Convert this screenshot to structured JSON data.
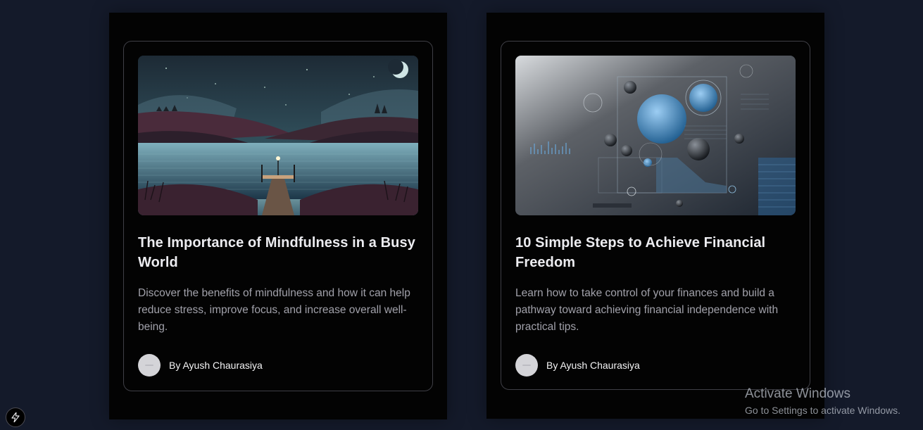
{
  "cards": [
    {
      "image_icon": "landscape-night-lake-image",
      "title": "The Importance of Mindfulness in a Busy World",
      "description": "Discover the benefits of mindfulness and how it can help reduce stress, improve focus, and increase overall well-being.",
      "author": "By Ayush Chaurasiya"
    },
    {
      "image_icon": "abstract-finance-spheres-image",
      "title": "10 Simple Steps to Achieve Financial Freedom",
      "description": "Learn how to take control of your finances and build a pathway toward achieving financial independence with practical tips.",
      "author": "By Ayush Chaurasiya"
    }
  ],
  "watermark": {
    "title": "Activate Windows",
    "subtitle": "Go to Settings to activate Windows."
  },
  "dev_tool": {
    "icon": "lightning-bolt-icon"
  },
  "colors": {
    "background": "#141a2a",
    "card": "#030303",
    "border": "#3f3f46",
    "title": "#ececf0",
    "text": "#a1a1aa"
  }
}
